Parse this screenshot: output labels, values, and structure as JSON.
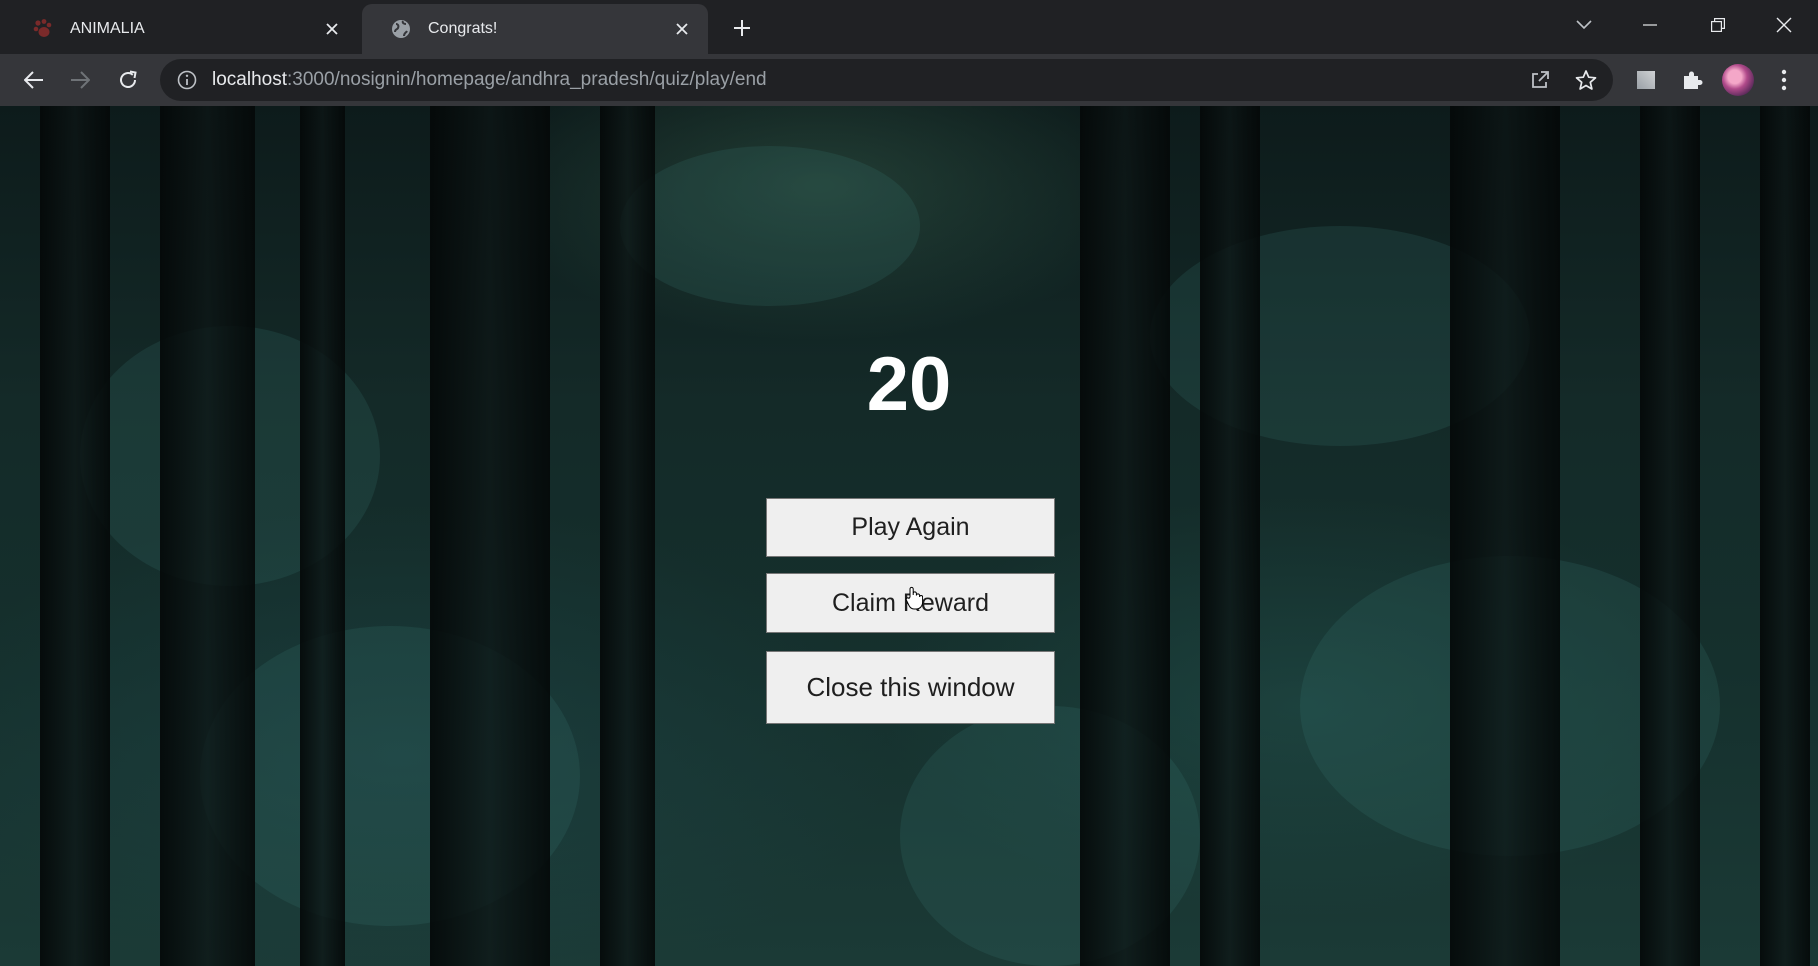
{
  "browser": {
    "tabs": [
      {
        "title": "ANIMALIA",
        "icon": "paw-logo-icon",
        "active": false
      },
      {
        "title": "Congrats!",
        "icon": "globe-icon",
        "active": true
      }
    ],
    "address_bar": {
      "host": "localhost",
      "path": ":3000/nosignin/homepage/andhra_pradesh/quiz/play/end"
    }
  },
  "page": {
    "score": "20",
    "buttons": {
      "play_again": "Play Again",
      "claim_reward": "Claim Reward",
      "close_window": "Close this window"
    }
  },
  "colors": {
    "chrome_dark": "#202124",
    "chrome_toolbar": "#35363a",
    "button_bg": "#efefef",
    "score_text": "#ffffff"
  }
}
